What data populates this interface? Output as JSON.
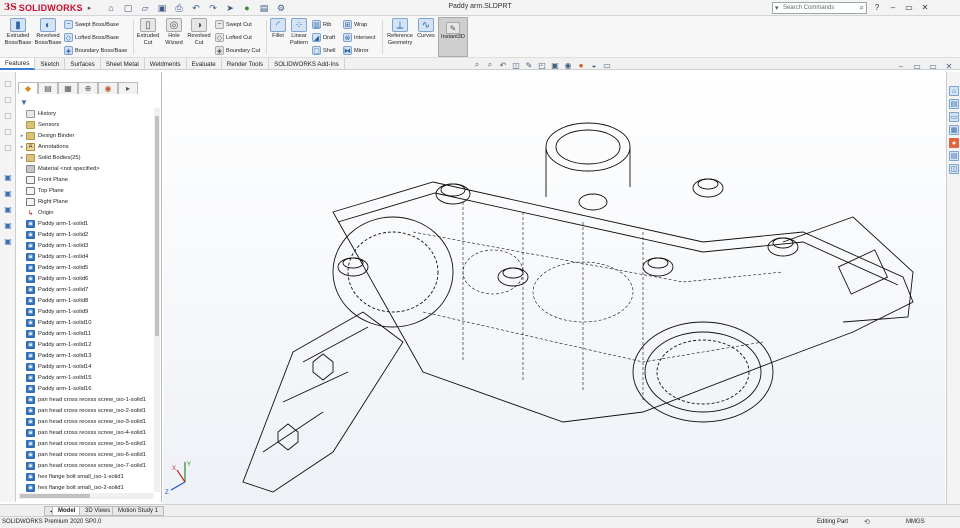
{
  "app": {
    "brand_prefix": "3S",
    "brand_name": "SOLIDWORKS",
    "document_title": "Paddy arm.SLDPRT",
    "search_placeholder": "Search Commands"
  },
  "quick_access": [
    "home-icon",
    "new-icon",
    "open-icon",
    "save-icon",
    "print-icon",
    "undo-icon",
    "redo-icon",
    "select-icon",
    "rebuild-icon",
    "file-properties-icon",
    "options-icon"
  ],
  "ribbon": {
    "extruded_boss": "Extruded Boss/Base",
    "revolved_boss": "Revolved Boss/Base",
    "swept_boss": "Swept Boss/Base",
    "lofted_boss": "Lofted Boss/Base",
    "boundary_boss": "Boundary Boss/Base",
    "extruded_cut": "Extruded Cut",
    "hole_wizard": "Hole Wizard",
    "revolved_cut": "Revolved Cut",
    "swept_cut": "Swept Cut",
    "lofted_cut": "Lofted Cut",
    "boundary_cut": "Boundary Cut",
    "fillet": "Fillet",
    "linear_pattern": "Linear Pattern",
    "rib": "Rib",
    "draft": "Draft",
    "shell": "Shell",
    "wrap": "Wrap",
    "intersect": "Intersect",
    "mirror": "Mirror",
    "reference_geometry": "Reference Geometry",
    "curves": "Curves",
    "instant3d": "Instant3D"
  },
  "command_tabs": [
    "Features",
    "Sketch",
    "Surfaces",
    "Sheet Metal",
    "Weldments",
    "Evaluate",
    "Render Tools",
    "SOLIDWORKS Add-Ins"
  ],
  "feature_tree": [
    {
      "label": "History",
      "icon": "hist",
      "exp": ""
    },
    {
      "label": "Sensors",
      "icon": "folder",
      "exp": ""
    },
    {
      "label": "Design Binder",
      "icon": "folder",
      "exp": "▸"
    },
    {
      "label": "Annotations",
      "icon": "annot",
      "exp": "▸"
    },
    {
      "label": "Solid Bodies(25)",
      "icon": "folder",
      "exp": "▸"
    },
    {
      "label": "Material <not specified>",
      "icon": "mat",
      "exp": ""
    },
    {
      "label": "Front Plane",
      "icon": "plane",
      "exp": ""
    },
    {
      "label": "Top Plane",
      "icon": "plane",
      "exp": ""
    },
    {
      "label": "Right Plane",
      "icon": "plane",
      "exp": ""
    },
    {
      "label": "Origin",
      "icon": "origin",
      "exp": ""
    },
    {
      "label": "Paddy arm-1-solid1",
      "icon": "body",
      "exp": ""
    },
    {
      "label": "Paddy arm-1-solid2",
      "icon": "body",
      "exp": ""
    },
    {
      "label": "Paddy arm-1-solid3",
      "icon": "body",
      "exp": ""
    },
    {
      "label": "Paddy arm-1-solid4",
      "icon": "body",
      "exp": ""
    },
    {
      "label": "Paddy arm-1-solid5",
      "icon": "body",
      "exp": ""
    },
    {
      "label": "Paddy arm-1-solid6",
      "icon": "body",
      "exp": ""
    },
    {
      "label": "Paddy arm-1-solid7",
      "icon": "body",
      "exp": ""
    },
    {
      "label": "Paddy arm-1-solid8",
      "icon": "body",
      "exp": ""
    },
    {
      "label": "Paddy arm-1-solid9",
      "icon": "body",
      "exp": ""
    },
    {
      "label": "Paddy arm-1-solid10",
      "icon": "body",
      "exp": ""
    },
    {
      "label": "Paddy arm-1-solid11",
      "icon": "body",
      "exp": ""
    },
    {
      "label": "Paddy arm-1-solid12",
      "icon": "body",
      "exp": ""
    },
    {
      "label": "Paddy arm-1-solid13",
      "icon": "body",
      "exp": ""
    },
    {
      "label": "Paddy arm-1-solid14",
      "icon": "body",
      "exp": ""
    },
    {
      "label": "Paddy arm-1-solid15",
      "icon": "body",
      "exp": ""
    },
    {
      "label": "Paddy arm-1-solid16",
      "icon": "body",
      "exp": ""
    },
    {
      "label": "pan head cross recess screw_iso-1-solid1",
      "icon": "body",
      "exp": ""
    },
    {
      "label": "pan head cross recess screw_iso-2-solid1",
      "icon": "body",
      "exp": ""
    },
    {
      "label": "pan head cross recess screw_iso-3-solid1",
      "icon": "body",
      "exp": ""
    },
    {
      "label": "pan head cross recess screw_iso-4-solid1",
      "icon": "body",
      "exp": ""
    },
    {
      "label": "pan head cross recess screw_iso-5-solid1",
      "icon": "body",
      "exp": ""
    },
    {
      "label": "pan head cross recess screw_iso-6-solid1",
      "icon": "body",
      "exp": ""
    },
    {
      "label": "pan head cross recess screw_iso-7-solid1",
      "icon": "body",
      "exp": ""
    },
    {
      "label": "hex flange bolt small_iso-1-solid1",
      "icon": "body",
      "exp": ""
    },
    {
      "label": "hex flange bolt small_iso-2-solid1",
      "icon": "body",
      "exp": ""
    }
  ],
  "bottom_tabs": [
    "Model",
    "3D Views",
    "Motion Study 1"
  ],
  "status": {
    "product": "SOLIDWORKS Premium 2020 SP0.0",
    "mode": "Editing Part",
    "units": "MMGS"
  },
  "colors": {
    "brand_red": "#c8102e",
    "accent_blue": "#3a7bd5",
    "body_icon": "#2d6eb6"
  },
  "axes": {
    "x": "X",
    "y": "Y",
    "z": "Z"
  }
}
